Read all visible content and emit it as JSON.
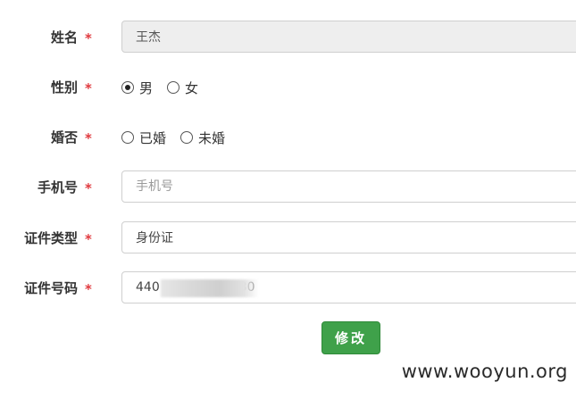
{
  "form": {
    "name": {
      "label": "姓名",
      "required": "*",
      "value": "王杰"
    },
    "gender": {
      "label": "性别",
      "required": "*",
      "options": [
        {
          "label": "男",
          "selected": true
        },
        {
          "label": "女",
          "selected": false
        }
      ]
    },
    "marital": {
      "label": "婚否",
      "required": "*",
      "options": [
        {
          "label": "已婚",
          "selected": false
        },
        {
          "label": "未婚",
          "selected": false
        }
      ]
    },
    "phone": {
      "label": "手机号",
      "required": "*",
      "value": "",
      "placeholder": "手机号"
    },
    "id_type": {
      "label": "证件类型",
      "required": "*",
      "value": "身份证"
    },
    "id_number": {
      "label": "证件号码",
      "required": "*",
      "value": "440                    30"
    },
    "submit_label": "修改"
  },
  "watermark": "www.wooyun.org"
}
